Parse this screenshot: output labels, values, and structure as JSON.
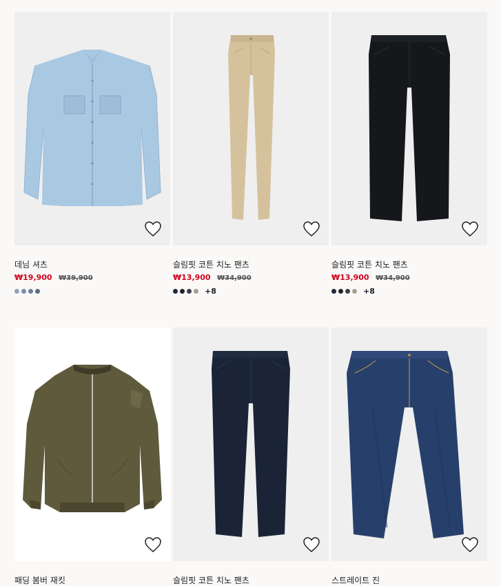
{
  "products": [
    {
      "name": "데님 셔츠",
      "sale_price": "₩19,900",
      "old_price": "₩39,900",
      "more": "",
      "swatches": [
        "#8fa3be",
        "#7d8ea6",
        "#6f7f96",
        "#5e6d84"
      ],
      "image": "denim-shirt-image"
    },
    {
      "name": "슬림핏 코튼 치노 팬츠",
      "sale_price": "₩13,900",
      "old_price": "₩34,900",
      "more": "+8",
      "swatches": [
        "#1e2a3c",
        "#222222",
        "#3a3f47",
        "#a7a08c"
      ],
      "image": "beige-chino-image"
    },
    {
      "name": "슬림핏 코튼 치노 팬츠",
      "sale_price": "₩13,900",
      "old_price": "₩34,900",
      "more": "+8",
      "swatches": [
        "#1e2a3c",
        "#222222",
        "#3a3f47",
        "#a7a08c"
      ],
      "image": "black-chino-image"
    },
    {
      "name": "패딩 봄버 재킷",
      "image": "bomber-jacket-image"
    },
    {
      "name": "슬림핏 코튼 치노 팬츠",
      "image": "navy-chino-image"
    },
    {
      "name": "스트레이트 진",
      "image": "straight-jeans-image"
    }
  ],
  "icons": {
    "favorite": "heart-outline-icon"
  }
}
